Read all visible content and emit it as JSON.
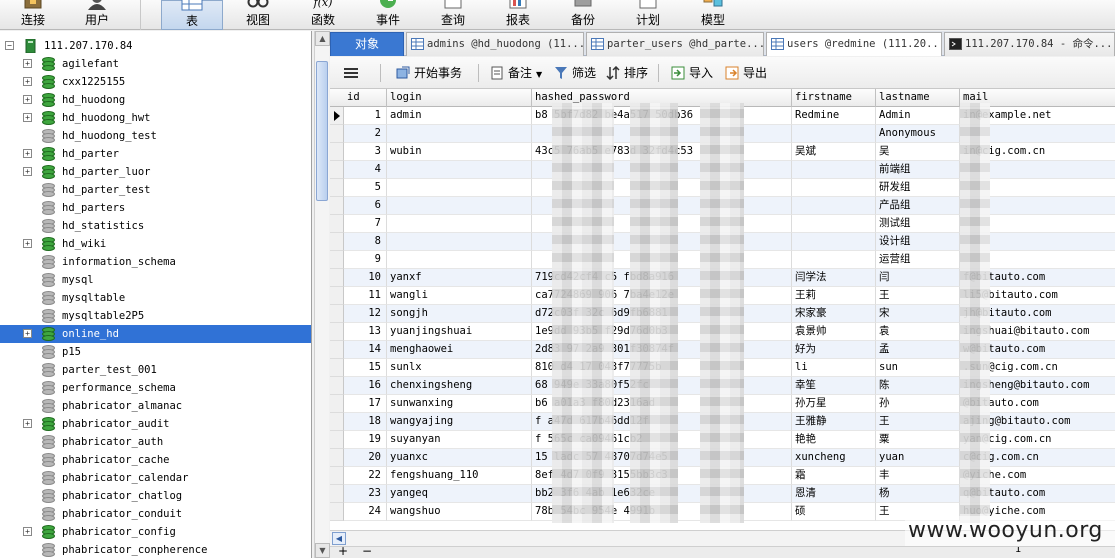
{
  "toolbar": {
    "buttons": [
      {
        "label": "连接",
        "icon": "plug-icon"
      },
      {
        "label": "用户",
        "icon": "user-icon"
      },
      {
        "label": "表",
        "icon": "table-icon"
      },
      {
        "label": "视图",
        "icon": "glasses-icon"
      },
      {
        "label": "函数",
        "icon": "function-icon"
      },
      {
        "label": "事件",
        "icon": "clock-icon"
      },
      {
        "label": "查询",
        "icon": "query-icon"
      },
      {
        "label": "报表",
        "icon": "report-icon"
      },
      {
        "label": "备份",
        "icon": "backup-icon"
      },
      {
        "label": "计划",
        "icon": "calendar-icon"
      },
      {
        "label": "模型",
        "icon": "model-icon"
      }
    ],
    "function_glyph": "f(x)"
  },
  "tree": {
    "connection": "111.207.170.84",
    "databases": [
      {
        "name": "agilefant",
        "expandable": true,
        "opened": true
      },
      {
        "name": "cxx1225155",
        "expandable": true,
        "opened": true
      },
      {
        "name": "hd_huodong",
        "expandable": true,
        "opened": true
      },
      {
        "name": "hd_huodong_hwt",
        "expandable": true,
        "opened": true
      },
      {
        "name": "hd_huodong_test",
        "expandable": false,
        "opened": false
      },
      {
        "name": "hd_parter",
        "expandable": true,
        "opened": true
      },
      {
        "name": "hd_parter_luor",
        "expandable": true,
        "opened": true
      },
      {
        "name": "hd_parter_test",
        "expandable": false,
        "opened": false
      },
      {
        "name": "hd_parters",
        "expandable": false,
        "opened": false
      },
      {
        "name": "hd_statistics",
        "expandable": false,
        "opened": false
      },
      {
        "name": "hd_wiki",
        "expandable": true,
        "opened": true
      },
      {
        "name": "information_schema",
        "expandable": false,
        "opened": false
      },
      {
        "name": "mysql",
        "expandable": false,
        "opened": false
      },
      {
        "name": "mysqltable",
        "expandable": false,
        "opened": false
      },
      {
        "name": "mysqltable2P5",
        "expandable": false,
        "opened": false
      },
      {
        "name": "online_hd",
        "expandable": true,
        "opened": true,
        "selected": true
      },
      {
        "name": "p15",
        "expandable": false,
        "opened": false
      },
      {
        "name": "parter_test_001",
        "expandable": false,
        "opened": false
      },
      {
        "name": "performance_schema",
        "expandable": false,
        "opened": false
      },
      {
        "name": "phabricator_almanac",
        "expandable": false,
        "opened": false
      },
      {
        "name": "phabricator_audit",
        "expandable": true,
        "opened": true
      },
      {
        "name": "phabricator_auth",
        "expandable": false,
        "opened": false
      },
      {
        "name": "phabricator_cache",
        "expandable": false,
        "opened": false
      },
      {
        "name": "phabricator_calendar",
        "expandable": false,
        "opened": false
      },
      {
        "name": "phabricator_chatlog",
        "expandable": false,
        "opened": false
      },
      {
        "name": "phabricator_conduit",
        "expandable": false,
        "opened": false
      },
      {
        "name": "phabricator_config",
        "expandable": true,
        "opened": true
      },
      {
        "name": "phabricator_conpherence",
        "expandable": false,
        "opened": false
      }
    ]
  },
  "tabs": [
    {
      "label": "对象"
    },
    {
      "label": "admins @hd_huodong (11...",
      "icon": "grid-icon"
    },
    {
      "label": "parter_users @hd_parte...",
      "icon": "grid-icon"
    },
    {
      "label": "users @redmine (111.20...",
      "icon": "grid-icon",
      "active": true
    },
    {
      "label": "111.207.170.84 - 命令...",
      "icon": "console-icon"
    }
  ],
  "data_toolbar": {
    "begin_transaction": "开始事务",
    "memo": "备注",
    "filter": "筛选",
    "sort": "排序",
    "import": "导入",
    "export": "导出"
  },
  "grid": {
    "columns": [
      "id",
      "login",
      "hashed_password",
      "firstname",
      "lastname",
      "mail"
    ],
    "rows": [
      {
        "id": "1",
        "login": "admin",
        "hashed_password": "b8   5bf7d82   be4a517   50db36",
        "firstname": "Redmine",
        "lastname": "Admin",
        "mail": "  in@example.net"
      },
      {
        "id": "2",
        "login": "",
        "hashed_password": "",
        "firstname": "",
        "lastname": "Anonymous",
        "mail": ""
      },
      {
        "id": "3",
        "login": "wubin",
        "hashed_password": "43c5   76ab5   e783d   32fd4c53",
        "firstname": "吴斌",
        "lastname": "吴",
        "mail": "  in@cig.com.cn"
      },
      {
        "id": "4",
        "login": "",
        "hashed_password": "",
        "firstname": "",
        "lastname": "前端组",
        "mail": ""
      },
      {
        "id": "5",
        "login": "",
        "hashed_password": "",
        "firstname": "",
        "lastname": "研发组",
        "mail": ""
      },
      {
        "id": "6",
        "login": "",
        "hashed_password": "",
        "firstname": "",
        "lastname": "产品组",
        "mail": ""
      },
      {
        "id": "7",
        "login": "",
        "hashed_password": "",
        "firstname": "",
        "lastname": "测试组",
        "mail": ""
      },
      {
        "id": "8",
        "login": "",
        "hashed_password": "",
        "firstname": "",
        "lastname": "设计组",
        "mail": ""
      },
      {
        "id": "9",
        "login": "",
        "hashed_password": "",
        "firstname": "",
        "lastname": "运营组",
        "mail": ""
      },
      {
        "id": "10",
        "login": "yanxf",
        "hashed_password": "719cd42cf4   c5   fbd8a916",
        "firstname": "闫学法",
        "lastname": "闫",
        "mail": "  f@bitauto.com"
      },
      {
        "id": "11",
        "login": "wangli",
        "hashed_password": "ca7724869   906   7ba4e12e",
        "firstname": "王莉",
        "lastname": "王",
        "mail": "  li5@bitauto.com"
      },
      {
        "id": "12",
        "login": "songjh",
        "hashed_password": "d72c03f   32c   6d9fb6881",
        "firstname": "宋家豪",
        "lastname": "宋",
        "mail": "  jh@bitauto.com"
      },
      {
        "id": "13",
        "login": "yuanjingshuai",
        "hashed_password": "1e9dd   93b5   f29d76d0b3",
        "firstname": "袁景帅",
        "lastname": "袁",
        "mail": "  ingshuai@bitauto.com"
      },
      {
        "id": "14",
        "login": "menghaowei",
        "hashed_password": "2d83   97   2a9   301f30874f",
        "firstname": "好为",
        "lastname": "孟",
        "mail": "  w@bitauto.com"
      },
      {
        "id": "15",
        "login": "sunlx",
        "hashed_password": "810   d4   17   043f77775b",
        "firstname": "li",
        "lastname": "sun",
        "mail": "  .sun@cig.com.cn"
      },
      {
        "id": "16",
        "login": "chenxingsheng",
        "hashed_password": "68   949e   33a80f52fc",
        "firstname": "幸笙",
        "lastname": "陈",
        "mail": "  ingsheng@bitauto.com"
      },
      {
        "id": "17",
        "login": "sunwanxing",
        "hashed_password": "b6   a01a3   f80d2316ad",
        "firstname": "孙万星",
        "lastname": "孙",
        "mail": "  @bitauto.com"
      },
      {
        "id": "18",
        "login": "wangyajing",
        "hashed_password": "f   a47d   617b46dd12f",
        "firstname": "王雅静",
        "lastname": "王",
        "mail": "  ajing@bitauto.com"
      },
      {
        "id": "19",
        "login": "suyanyan",
        "hashed_password": "f   565c   ca09461cb2",
        "firstname": "艳艳",
        "lastname": "粟",
        "mail": "  yan@cig.com.cn"
      },
      {
        "id": "20",
        "login": "yuanxc",
        "hashed_password": "15   ladc   57   48707d74e5",
        "firstname": "xuncheng",
        "lastname": "yuan",
        "mail": "  c@cig.com.cn"
      },
      {
        "id": "22",
        "login": "fengshuang_110",
        "hashed_password": "8ef   4d7   0f9   3155bb3c3",
        "firstname": "霜",
        "lastname": "丰",
        "mail": "  @yiche.com"
      },
      {
        "id": "23",
        "login": "yangeq",
        "hashed_password": "bb2   3f6   4ab   1e632ce",
        "firstname": "恩清",
        "lastname": "杨",
        "mail": "  q@bitauto.com"
      },
      {
        "id": "24",
        "login": "wangshuo",
        "hashed_password": "78b   54bc   954e   4991b",
        "firstname": "硕",
        "lastname": "王",
        "mail": "  huo@yiche.com"
      }
    ]
  },
  "watermark": "www.wooyun.org",
  "pagination": {
    "page": "1"
  }
}
